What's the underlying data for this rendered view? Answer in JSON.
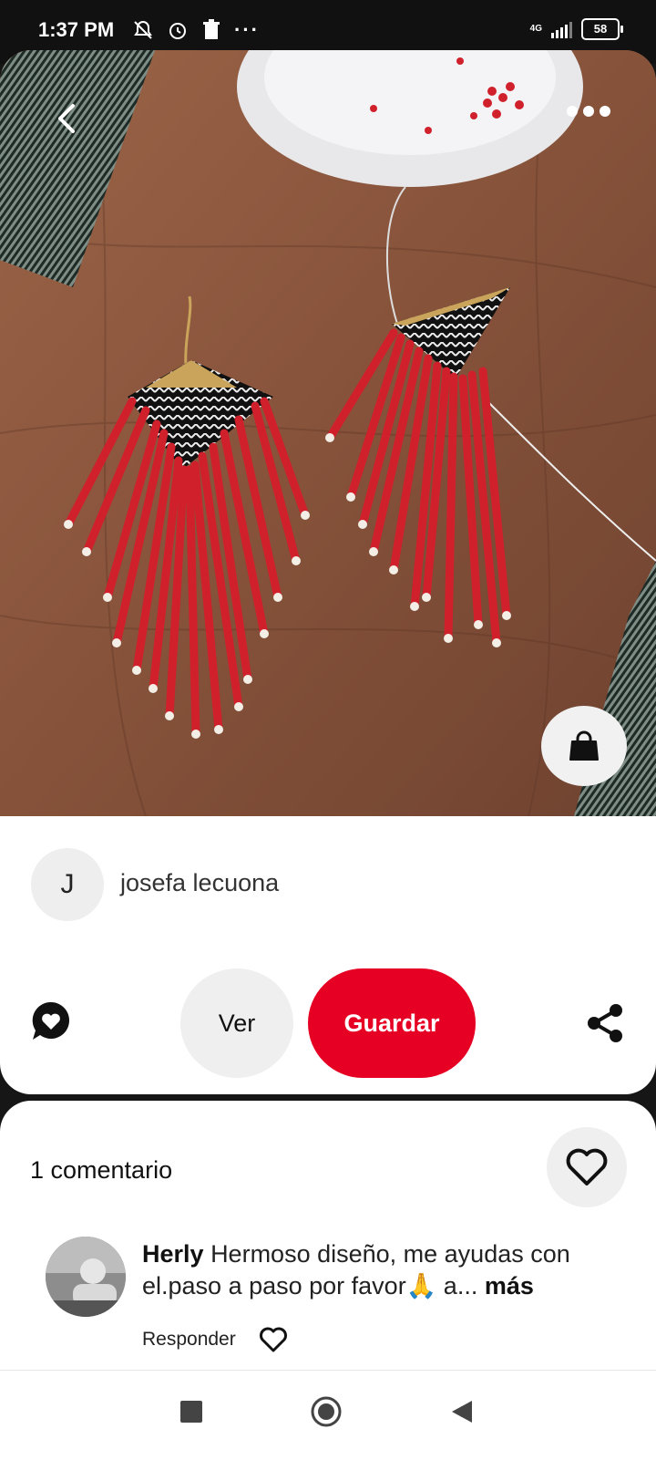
{
  "status_bar": {
    "time": "1:37 PM",
    "network": "4G",
    "battery": "58"
  },
  "pin": {
    "creator_initial": "J",
    "creator_name": "josefa lecuona",
    "actions": {
      "view_label": "Ver",
      "save_label": "Guardar"
    }
  },
  "comments": {
    "count_label": "1 comentario",
    "items": [
      {
        "author": "Herly",
        "text": "Hermoso diseño, me ayudas con el.paso a paso por favor🙏 a...",
        "more_label": "más",
        "reply_label": "Responder"
      }
    ]
  },
  "colors": {
    "accent": "#e60023",
    "surface": "#ffffff",
    "chip": "#efefef"
  },
  "icons": [
    "back-arrow-icon",
    "more-dots-icon",
    "shopping-bag-icon",
    "chat-heart-icon",
    "share-icon",
    "heart-outline-icon"
  ]
}
